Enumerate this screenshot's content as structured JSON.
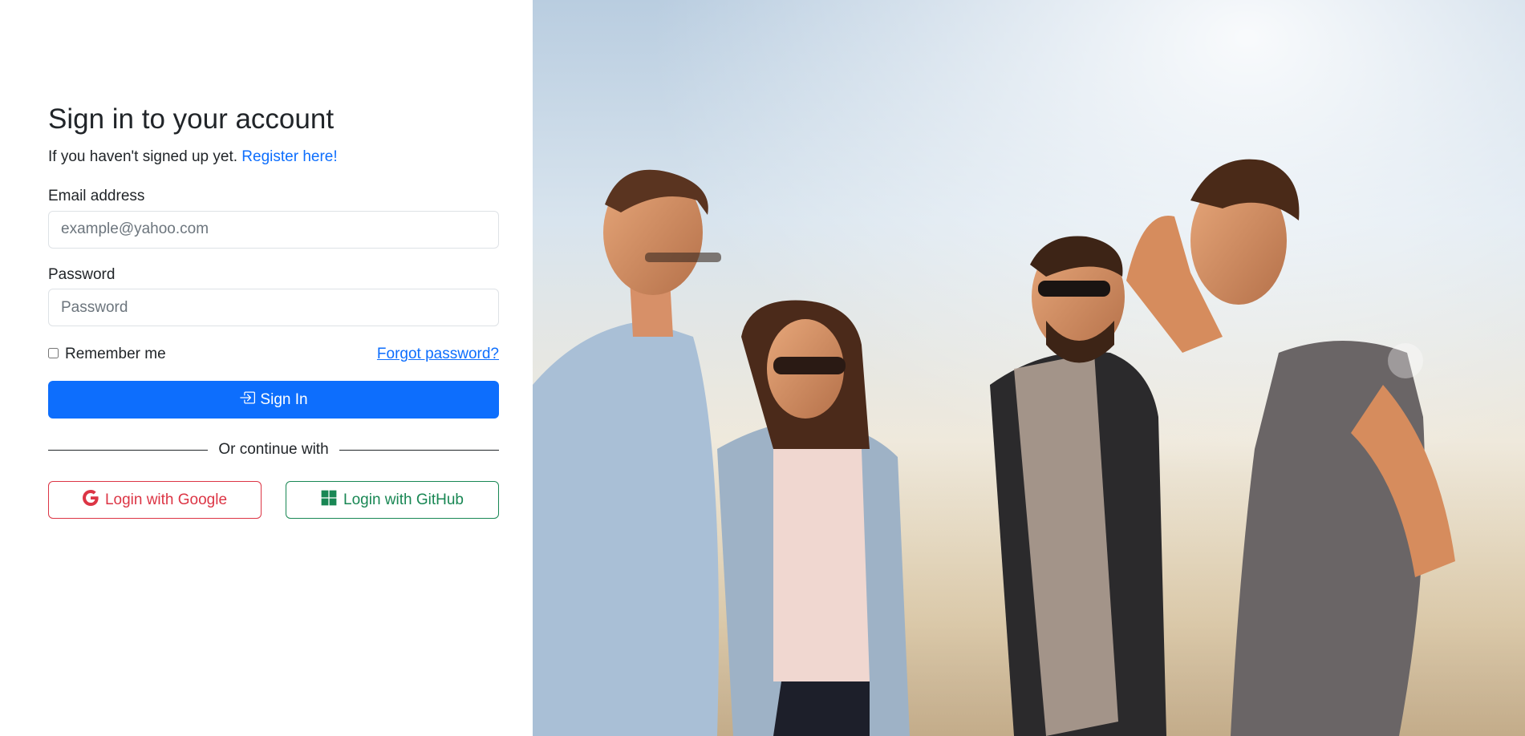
{
  "login": {
    "title": "Sign in to your account",
    "subtitle_text": "If you haven't signed up yet.",
    "register_link": "Register here!",
    "email_label": "Email address",
    "email_placeholder": "example@yahoo.com",
    "password_label": "Password",
    "password_placeholder": "Password",
    "remember_label": "Remember me",
    "forgot_link": "Forgot password?",
    "signin_label": "Sign In",
    "divider_text": "Or continue with",
    "google_label": "Login with Google",
    "github_label": "Login with GitHub"
  },
  "icons": {
    "signin": "box-arrow-in-right-icon",
    "google": "google-icon",
    "github": "windows-grid-icon"
  },
  "colors": {
    "primary": "#0d6efd",
    "google": "#dc3545",
    "github": "#198754",
    "text": "#212529"
  }
}
